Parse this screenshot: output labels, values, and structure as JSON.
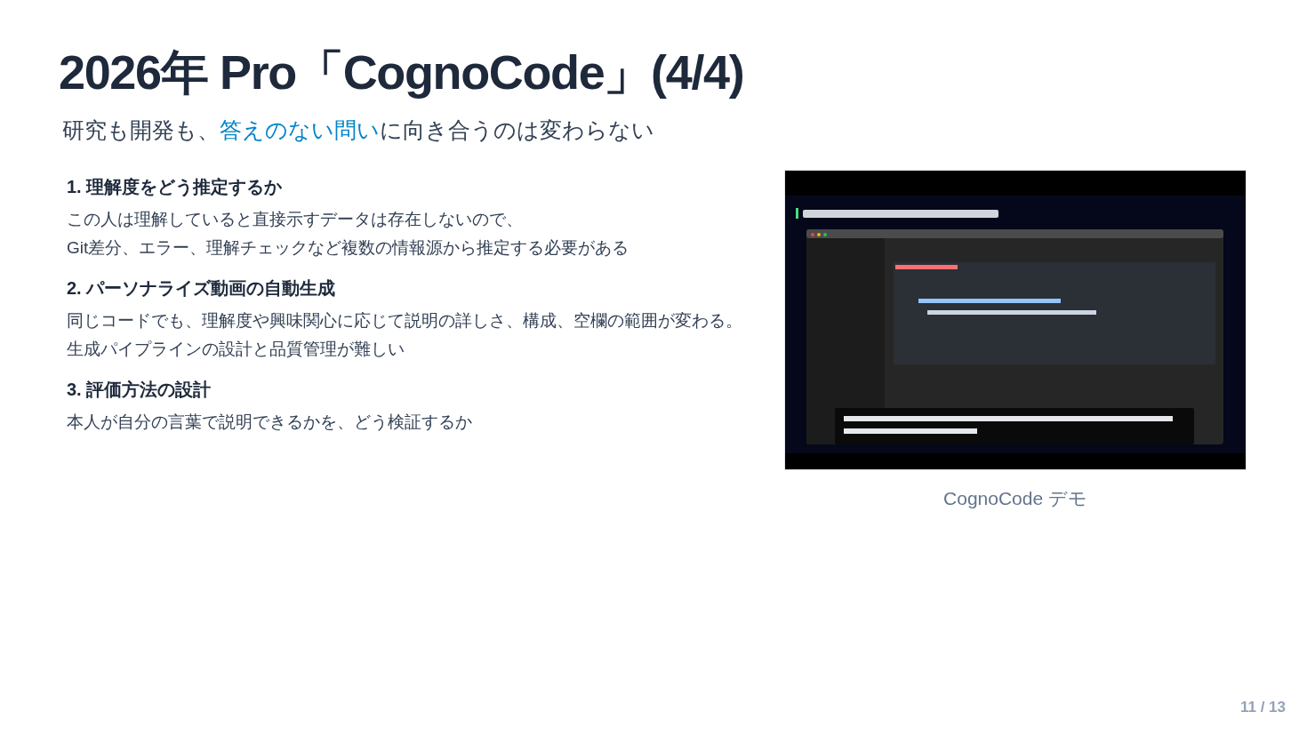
{
  "title": "2026年 Pro「CognoCode」(4/4)",
  "subtitle": [
    {
      "text": "研究も開発も、",
      "highlight": false
    },
    {
      "text": "答えのない問い",
      "highlight": true
    },
    {
      "text": "に向き合うのは変わらない",
      "highlight": false
    }
  ],
  "sections": [
    {
      "heading": "1. 理解度をどう推定するか",
      "lines": [
        "この人は理解していると直接示すデータは存在しないので、",
        "Git差分、エラー、理解チェックなど複数の情報源から推定する必要がある"
      ]
    },
    {
      "heading": "2. パーソナライズ動画の自動生成",
      "lines": [
        "同じコードでも、理解度や興味関心に応じて説明の詳しさ、構成、空欄の範囲が変わる。",
        "生成パイプラインの設計と品質管理が難しい"
      ]
    },
    {
      "heading": "3. 評価方法の設計",
      "lines": [
        "本人が自分の言葉で説明できるかを、どう検証するか"
      ]
    }
  ],
  "figure": {
    "kind": "picture",
    "caption": "CognoCode デモ"
  },
  "page_number": "11 / 13"
}
